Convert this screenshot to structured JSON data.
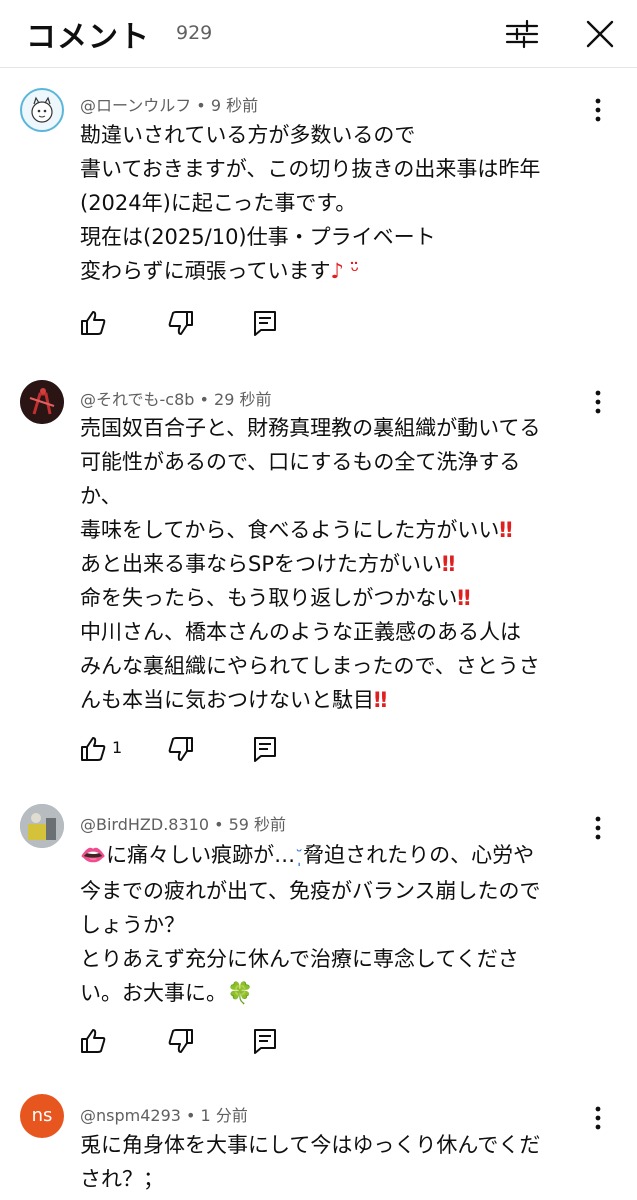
{
  "header": {
    "title": "コメント",
    "count": "929"
  },
  "comments": [
    {
      "author": "@ローンウルフ",
      "time": "9 秒前",
      "lines": [
        "勘違いされている方が多数いるので",
        "書いておきますが、この切り抜きの出来事は昨年",
        "(2024年)に起こった事です。",
        "現在は(2025/10)仕事・プライベート",
        "変わらずに頑張っています"
      ],
      "emoji_tail": "♪ ᵕ̈",
      "likes": ""
    },
    {
      "author": "@それでも-c8b",
      "time": "29 秒前",
      "lines": [
        "売国奴百合子と、財務真理教の裏組織が動いてる",
        "可能性があるので、口にするもの全て洗浄する",
        "か、",
        "毒味をしてから、食べるようにした方がいい",
        "あと出来る事ならSPをつけた方がいい",
        "命を失ったら、もう取り返しがつかない",
        "中川さん、橋本さんのような正義感のある人は",
        "みんな裏組織にやられてしまったので、さとうさ",
        "んも本当に気おつけないと駄目"
      ],
      "marks": "‼",
      "likes": "1"
    },
    {
      "author": "@BirdHZD.8310",
      "time": "59 秒前",
      "lines": [
        "に痛々しい痕跡が…",
        "脅迫されたりの、心労や",
        "今までの疲れが出て、免疫がバランス崩したので",
        "しょうか？",
        "とりあえず充分に休んで治療に専念してくださ",
        "い。お大事に。"
      ],
      "emoji_lips": "👄",
      "emoji_tear": "˘̩̩̩",
      "emoji_clover": "🍀",
      "likes": ""
    },
    {
      "author": "@nspm4293",
      "time": "1 分前",
      "avatar_text": "ns",
      "lines": [
        "兎に角身体を大事にして今はゆっくり休んでくだ",
        "され？；"
      ],
      "likes": ""
    }
  ],
  "meta_separator": " • ",
  "colors": {
    "accent_red": "#e02020",
    "avatar_orange": "#e8561f",
    "meta_gray": "#606060"
  },
  "icons": [
    "filter-icon",
    "close-icon",
    "more-vert-icon",
    "thumb-up-icon",
    "thumb-down-icon",
    "reply-icon"
  ]
}
